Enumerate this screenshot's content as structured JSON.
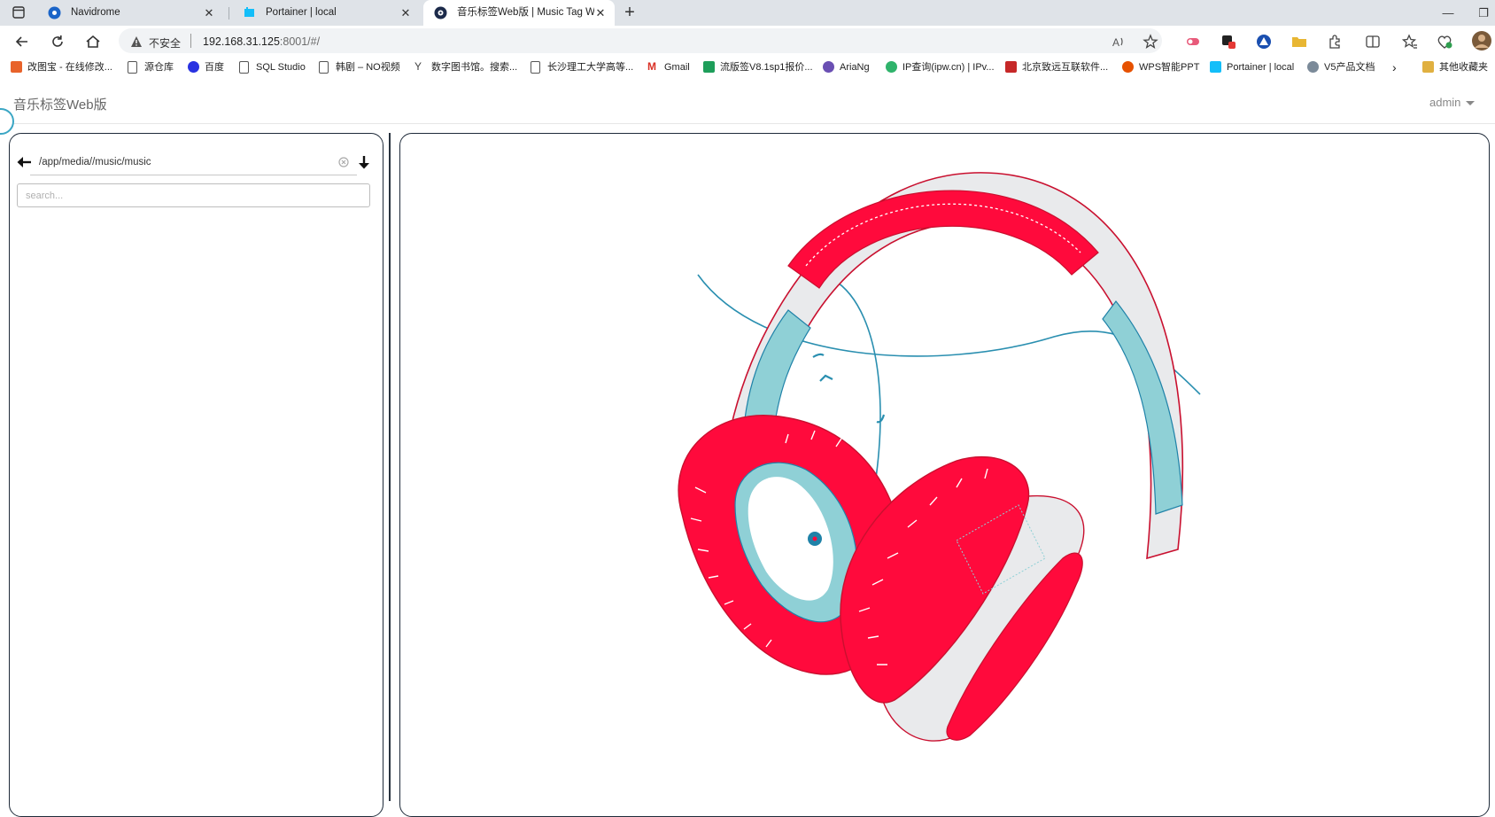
{
  "browser": {
    "tabs": [
      {
        "label": "Navidrome",
        "icon": "navidrome-icon"
      },
      {
        "label": "Portainer | local",
        "icon": "portainer-icon"
      },
      {
        "label": "音乐标签Web版 | Music Tag Web",
        "icon": "music-tag-icon"
      }
    ],
    "address": {
      "security_label": "不安全",
      "host": "192.168.31.125",
      "rest": ":8001/#/"
    },
    "bookmarks": [
      {
        "label": "改图宝 - 在线修改...",
        "color": "#e8632b"
      },
      {
        "label": "源仓库",
        "color": "#555555"
      },
      {
        "label": "百度",
        "color": "#2932e1"
      },
      {
        "label": "SQL Studio",
        "color": "#555555"
      },
      {
        "label": "韩剧 – NO视频",
        "color": "#555555"
      },
      {
        "label": "数字图书馆。搜索...",
        "color": "#444444"
      },
      {
        "label": "长沙理工大学高等...",
        "color": "#555555"
      },
      {
        "label": "Gmail",
        "color": "#d93025"
      },
      {
        "label": "流版签V8.1sp1报价...",
        "color": "#1e9e5a"
      },
      {
        "label": "AriaNg",
        "color": "#6a4fb3"
      },
      {
        "label": "IP查询(ipw.cn) | IPv...",
        "color": "#2fb36b"
      },
      {
        "label": "北京致远互联软件...",
        "color": "#c62828"
      },
      {
        "label": "WPS智能PPT",
        "color": "#e65100"
      },
      {
        "label": "Portainer | local",
        "color": "#13bef9"
      },
      {
        "label": "V5产品文档",
        "color": "#7b8a99"
      },
      {
        "label": "其他收藏夹",
        "color": "#e0b040"
      }
    ]
  },
  "app": {
    "brand": "音乐标签Web版",
    "user": "admin",
    "file_browser": {
      "path": "/app/media//music/music",
      "search_placeholder": "search..."
    }
  },
  "colors": {
    "accent_red": "#ff0a3c",
    "accent_teal": "#8fd0d6",
    "accent_blue": "#1f82a8",
    "panel_border": "#1f2b3a"
  }
}
